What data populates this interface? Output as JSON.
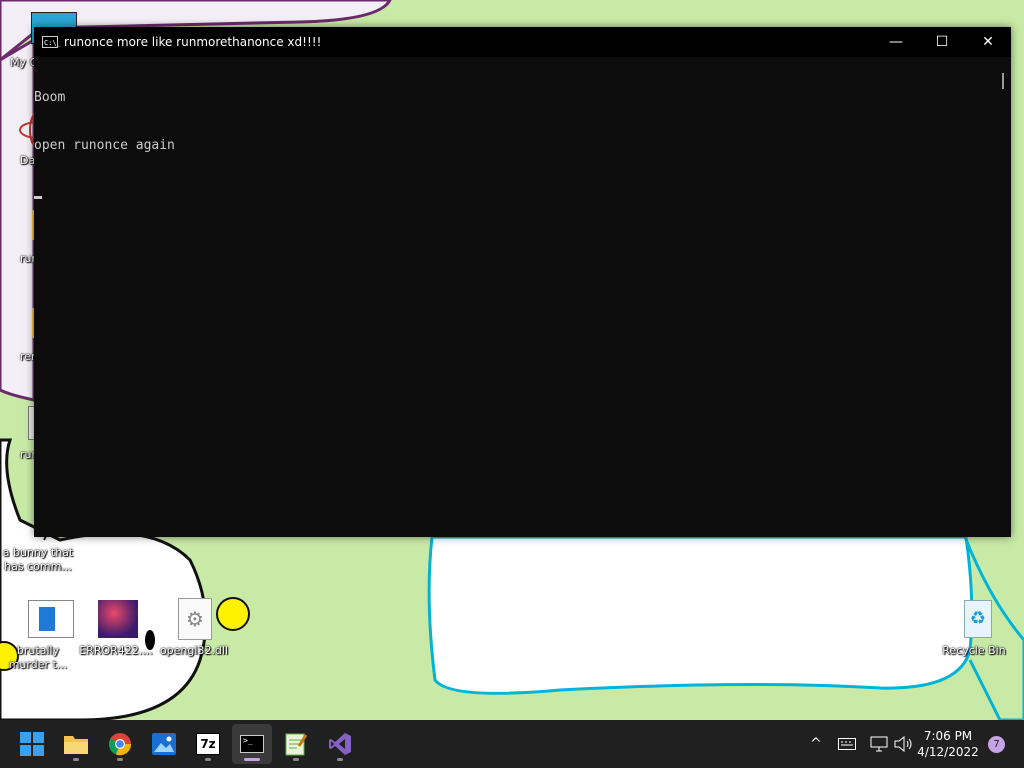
{
  "window": {
    "title": "runonce more like runmorethanonce xd!!!!",
    "minimize_glyph": "—",
    "maximize_glyph": "☐",
    "close_glyph": "✕",
    "console_lines": [
      "Boom",
      "open runonce again"
    ]
  },
  "desktop": {
    "icons": [
      {
        "label": "My C...",
        "icon": "monitor-icon"
      },
      {
        "label": "DataW...",
        "icon": "atom-icon"
      },
      {
        "label": "runon...",
        "icon": "folder-icon"
      },
      {
        "label": "reme...",
        "icon": "folder-icon"
      },
      {
        "label": "runm...",
        "icon": "app-icon"
      },
      {
        "label": "a bunny that has comm...",
        "icon": "bunny-icon"
      },
      {
        "label": "brutally murder t...",
        "icon": "app-icon"
      },
      {
        "label": "ERROR422....",
        "icon": "cube-icon"
      },
      {
        "label": "opengl32.dll",
        "icon": "dll-icon"
      },
      {
        "label": "Recycle Bin",
        "icon": "recycle-bin-icon"
      }
    ]
  },
  "taskbar": {
    "apps": [
      {
        "name": "start",
        "icon": "windows-logo-icon"
      },
      {
        "name": "file-explorer",
        "icon": "folder-icon"
      },
      {
        "name": "chrome",
        "icon": "chrome-icon"
      },
      {
        "name": "photos",
        "icon": "photos-icon"
      },
      {
        "name": "7zip",
        "icon": "7zip-icon",
        "label": "7z"
      },
      {
        "name": "terminal",
        "icon": "terminal-icon",
        "active": true
      },
      {
        "name": "notepad-plus",
        "icon": "notepad-icon"
      },
      {
        "name": "visual-studio",
        "icon": "visual-studio-icon"
      }
    ],
    "clock_time": "7:06 PM",
    "clock_date": "4/12/2022",
    "notification_count": "7",
    "tray_chevron": "^"
  },
  "colors": {
    "wallpaper": "#c8eaa6",
    "console_bg": "#0c0c0c",
    "taskbar_bg": "#202020",
    "accent": "#c6a3e6"
  }
}
